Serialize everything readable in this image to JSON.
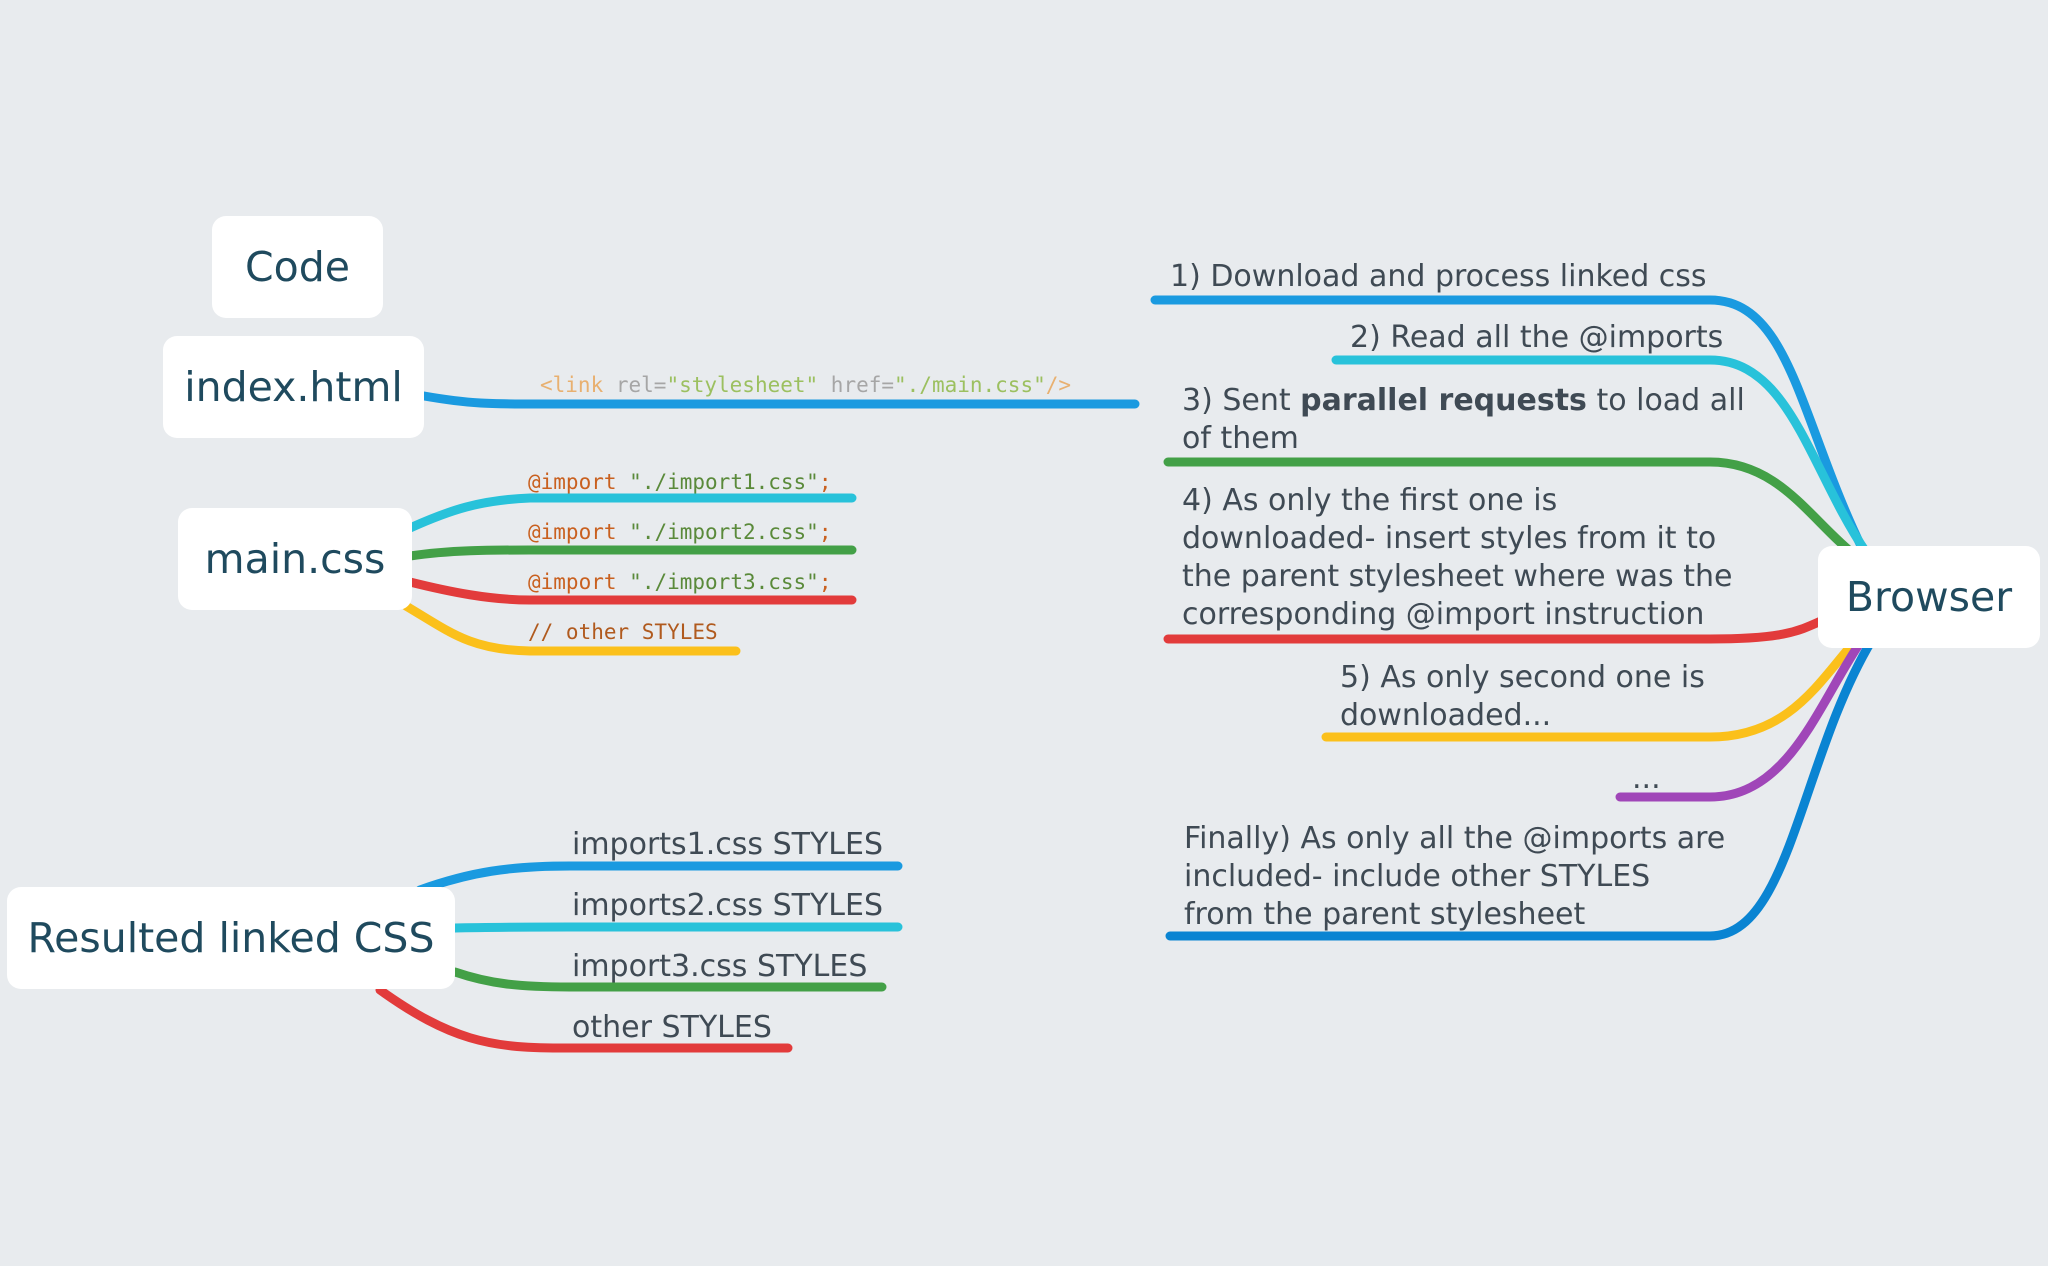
{
  "colors": {
    "background": "#e8ebee",
    "blue": "#1a9ae0",
    "cyan": "#28c2da",
    "green": "#43a047",
    "red": "#e23b3b",
    "yellow": "#fbc01b",
    "purple": "#a046b8",
    "dark_blue": "#0a84d2"
  },
  "nodes": {
    "code": "Code",
    "index_html": "index.html",
    "main_css": "main.css",
    "resulted": "Resulted linked CSS",
    "browser": "Browser"
  },
  "link_code": {
    "tag_open": "<link ",
    "rel_attr": "rel=",
    "rel_val": "\"stylesheet\"",
    "href_attr": " href=",
    "href_val": "\"./main.css\"",
    "tag_close": "/>"
  },
  "main_css_lines": [
    {
      "keyword": "@import",
      "value": "\"./import1.css\"",
      "end": ";"
    },
    {
      "keyword": "@import",
      "value": "\"./import2.css\"",
      "end": ";"
    },
    {
      "keyword": "@import",
      "value": "\"./import3.css\"",
      "end": ";"
    }
  ],
  "main_css_comment": "// other STYLES",
  "resulted_items": [
    "imports1.css STYLES",
    "imports2.css STYLES",
    "import3.css STYLES",
    "other STYLES"
  ],
  "steps": {
    "step1": "1) Download and process linked css",
    "step2": "2) Read all the @imports",
    "step3_pre": "3) Sent ",
    "step3_bold": "parallel requests",
    "step3_post": " to load all",
    "step3_line2": "of them",
    "step4_lines": [
      "4) As only the first one is",
      "downloaded- insert styles from it to",
      "the parent stylesheet where was the",
      "corresponding @import instruction"
    ],
    "step5_lines": [
      "5) As only second one is",
      "downloaded..."
    ],
    "ellipsis": "...",
    "final_lines": [
      "Finally) As only all the @imports are",
      "included- include other STYLES",
      "from the parent stylesheet"
    ]
  }
}
